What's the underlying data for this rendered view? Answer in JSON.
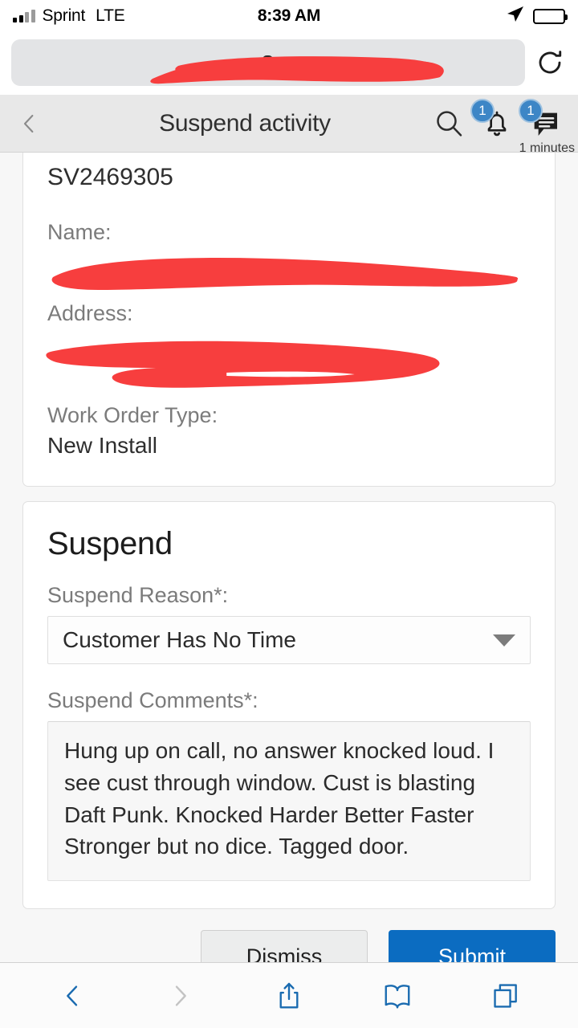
{
  "status_bar": {
    "carrier": "Sprint",
    "network": "LTE",
    "time": "8:39 AM",
    "location_icon": "location-arrow-icon",
    "battery_icon": "battery-full-icon",
    "signal_icon": "signal-bars-icon"
  },
  "browser": {
    "url_text": "",
    "url_redacted": true,
    "lock_icon": "lock-icon",
    "reload_icon": "reload-icon",
    "toolbar": {
      "back_icon": "chevron-left-icon",
      "forward_icon": "chevron-right-icon",
      "share_icon": "share-icon",
      "bookmarks_icon": "book-icon",
      "tabs_icon": "tabs-icon"
    }
  },
  "app_header": {
    "back_icon": "chevron-left-icon",
    "title": "Suspend activity",
    "search_icon": "search-icon",
    "bell_icon": "bell-icon",
    "bell_badge": "1",
    "message_icon": "message-icon",
    "message_badge": "1",
    "minutes_label": "1 minutes"
  },
  "order_card": {
    "order_id": "SV2469305",
    "name_label": "Name:",
    "name_value": "",
    "name_redacted": true,
    "address_label": "Address:",
    "address_value": "",
    "address_redacted": true,
    "work_order_type_label": "Work Order Type:",
    "work_order_type_value": "New Install"
  },
  "suspend_card": {
    "title": "Suspend",
    "reason_label": "Suspend Reason*:",
    "reason_value": "Customer Has No Time",
    "reason_caret_icon": "chevron-down-icon",
    "comments_label": "Suspend Comments*:",
    "comments_value": "Hung up on call, no answer knocked loud. I see cust through window. Cust is blasting Daft Punk. Knocked Harder Better Faster Stronger but no dice. Tagged door.",
    "comments_placeholder": ""
  },
  "actions": {
    "dismiss_label": "Dismiss",
    "submit_label": "Submit"
  },
  "colors": {
    "submit_blue": "#0b6cc1",
    "badge_blue": "#3d86c6",
    "redaction_red": "#f73e3e",
    "header_gray": "#e8e8e8",
    "page_gray": "#f7f7f7",
    "toolbar_blue": "#1a6bb0"
  }
}
